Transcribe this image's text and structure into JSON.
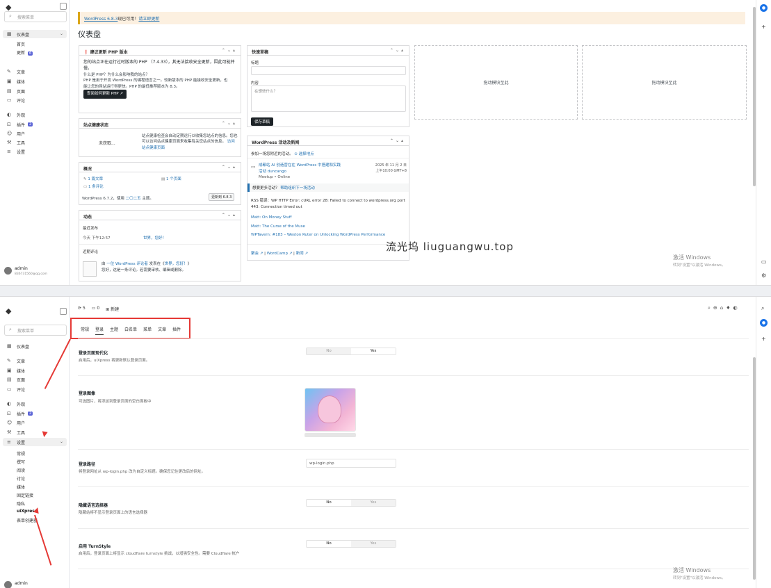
{
  "top": {
    "sidebar": {
      "search_placeholder": "搜索菜单",
      "dashboard": "仪表盘",
      "home": "首页",
      "updates": "更新",
      "updates_badge": "6",
      "posts": "文章",
      "media": "媒体",
      "pages": "页面",
      "comments": "评论",
      "appearance": "外观",
      "plugins": "插件",
      "plugins_badge": "2",
      "users": "用户",
      "tools": "工具",
      "settings": "设置",
      "user_name": "admin",
      "user_email": "836731560@qq.com"
    },
    "notice": {
      "link1": "WordPress 6.8.3",
      "text": "现已可用！",
      "link2": "请立即更新"
    },
    "title": "仪表盘",
    "php_box": {
      "title": "建议更新 PHP 版本",
      "body1": "您的站点正在运行过时版本的 PHP （7.4.33），其无法接收安全更新，因此可能并",
      "body1b": "慢。",
      "q": "什么是 PHP？为什么会影响我的站点？",
      "body2": "PHP 是用于开发 WordPress 的编程语言之一。较新版本的 PHP 能接收安全更新，也",
      "body2b": "能让您的网站运行得更快。PHP 的最低推荐版本为 8.3。",
      "button": "查阅如何更新 PHP"
    },
    "health_box": {
      "title": "站点健康状态",
      "status": "未获取...",
      "body": "站点健康检查会自动定期运行以收集您站点的信息。您也可以访问站点健康页面来收集有关您站点的信息。",
      "link": "访问站点健康页面"
    },
    "glance_box": {
      "title": "概况",
      "posts": "1 篇文章",
      "pages": "1 个页面",
      "comments": "1 条评论",
      "version_a": "WordPress 6.7.2，使用",
      "theme": "二〇二五",
      "version_b": "主题。",
      "update_btn": "更新到 6.8.3"
    },
    "activity_box": {
      "title": "动态",
      "recent": "最近发布",
      "time": "今天 下午12:57",
      "post": "世界，您好！",
      "recent_comments": "近期评论",
      "comment_from": "由",
      "commenter": "一位 WordPress 评论者",
      "on": "发表在《",
      "post_link": "世界，您好！",
      "close": "》",
      "comment_text": "您好，这是一条评论。若需要审核、编辑或删除。"
    },
    "quick_box": {
      "title": "快速草稿",
      "title_label": "标题",
      "content_label": "内容",
      "content_placeholder": "在想些什么？",
      "button": "保存草稿"
    },
    "events_box": {
      "title": "WordPress 活动及新闻",
      "city": "参加一场您附近的活动。",
      "location": "选择地点",
      "event_title": "成都站 AI 创造营在在 WordPress 中搭建和实践",
      "event_sub": "活动 duncango",
      "event_place": "Meetup • Online",
      "event_date": "2025 年 11 月 2 日",
      "event_time": "上午10:00 GMT+8",
      "want_more": "想要更多活动？",
      "help_link": "帮助组织下一场活动",
      "rss_error": "RSS 错误：WP HTTP Error: cURL error 28: Failed to connect to wordpress.org port 443: Connection timed out",
      "news1": "Matt: On Money Stuff",
      "news2": "Matt: The Curse of the Muse",
      "news3": "WPTavern: #183 – Weston Ruter on Unlocking WordPress Performance",
      "footer1": "聚会",
      "footer2": "WordCamp",
      "footer3": "新闻"
    },
    "dropzone": "拖动模块至此",
    "watermark": "流光坞 liuguangwu.top",
    "activate_title": "激活 Windows",
    "activate_sub": "转到\"设置\"以激活 Windows。"
  },
  "bottom": {
    "toprow": {
      "a": "5",
      "b": "0",
      "new": "新建"
    },
    "sidebar": {
      "search_placeholder": "搜索菜单",
      "dashboard": "仪表盘",
      "posts": "文章",
      "media": "媒体",
      "pages": "页面",
      "comments": "评论",
      "appearance": "外观",
      "plugins": "插件",
      "plugins_badge": "2",
      "users": "用户",
      "tools": "工具",
      "settings": "设置",
      "sub": [
        "常规",
        "撰写",
        "阅读",
        "讨论",
        "媒体",
        "固定链接",
        "隐私",
        "uiXpress",
        "表单创建器"
      ],
      "user_name": "admin"
    },
    "tabs": [
      "常规",
      "登录",
      "主题",
      "白名单",
      "菜单",
      "文章",
      "插件"
    ],
    "options": [
      {
        "title": "登录页面现代化",
        "desc": "启用后，uiXpress 将更新默认登录页面。",
        "no": "No",
        "yes": "Yes"
      },
      {
        "title": "登录图像",
        "desc": "可选图片，将添加到登录页面的空白面板中"
      },
      {
        "title": "登录路径",
        "desc": "将登录网址从 wp-login.php 改为自定义标题。确保您记住更改后的网址。",
        "value": "wp-login.php"
      },
      {
        "title": "隐藏语言选择器",
        "desc": "隐藏站将不显示登录页面上的语言选择器",
        "no": "No",
        "yes": "Yes"
      },
      {
        "title": "启用 TurnStyle",
        "desc": "启用后，登录页面上将显示 cloudflare turnstyle 挑战，以增强安全性。需要 Cloudflare 帐户",
        "no": "No",
        "yes": "Yes"
      }
    ],
    "activate_title": "激活 Windows",
    "activate_sub": "转到\"设置\"以激活 Windows。"
  },
  "colors": {
    "accent": "#2271b1",
    "red": "#e53935",
    "badge": "#5b64d6",
    "notice": "#fcf0e0"
  }
}
